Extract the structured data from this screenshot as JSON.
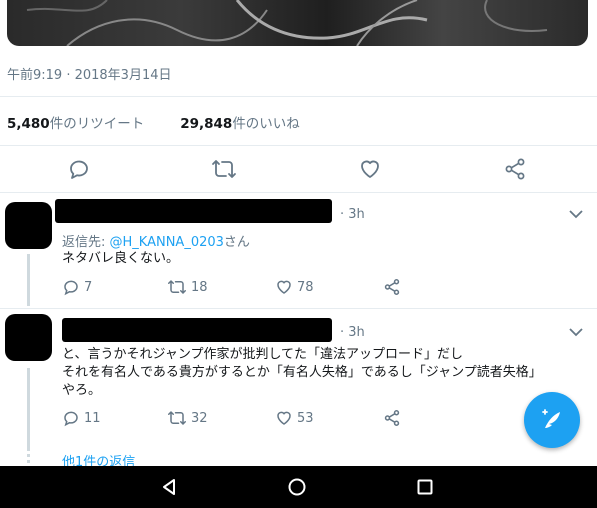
{
  "tweet": {
    "timestamp": "午前9:19 · 2018年3月14日",
    "retweets": {
      "count": "5,480",
      "label": "件のリツイート"
    },
    "likes": {
      "count": "29,848",
      "label": "件のいいね"
    }
  },
  "action_bar": {
    "icons": [
      "reply-icon",
      "retweet-icon",
      "like-icon",
      "share-icon"
    ]
  },
  "replies": [
    {
      "time": "· 3h",
      "reply_prefix": "返信先: ",
      "reply_handle": "@H_KANNA_0203",
      "reply_suffix": "さん",
      "lines": [
        "ネタバレ良くない。"
      ],
      "reply_count": "7",
      "retweet_count": "18",
      "like_count": "78"
    },
    {
      "time": "· 3h",
      "lines": [
        "と、言うかそれジャンプ作家が批判してた「違法アップロード」だし",
        "それを有名人である貴方がするとか「有名人失格」であるし「ジャンプ読者失格」",
        "やろ。"
      ],
      "reply_count": "11",
      "retweet_count": "32",
      "like_count": "53"
    }
  ],
  "more_replies": "他1件の返信",
  "colors": {
    "accent": "#1da1f2",
    "muted": "#657786",
    "text": "#14171a"
  }
}
